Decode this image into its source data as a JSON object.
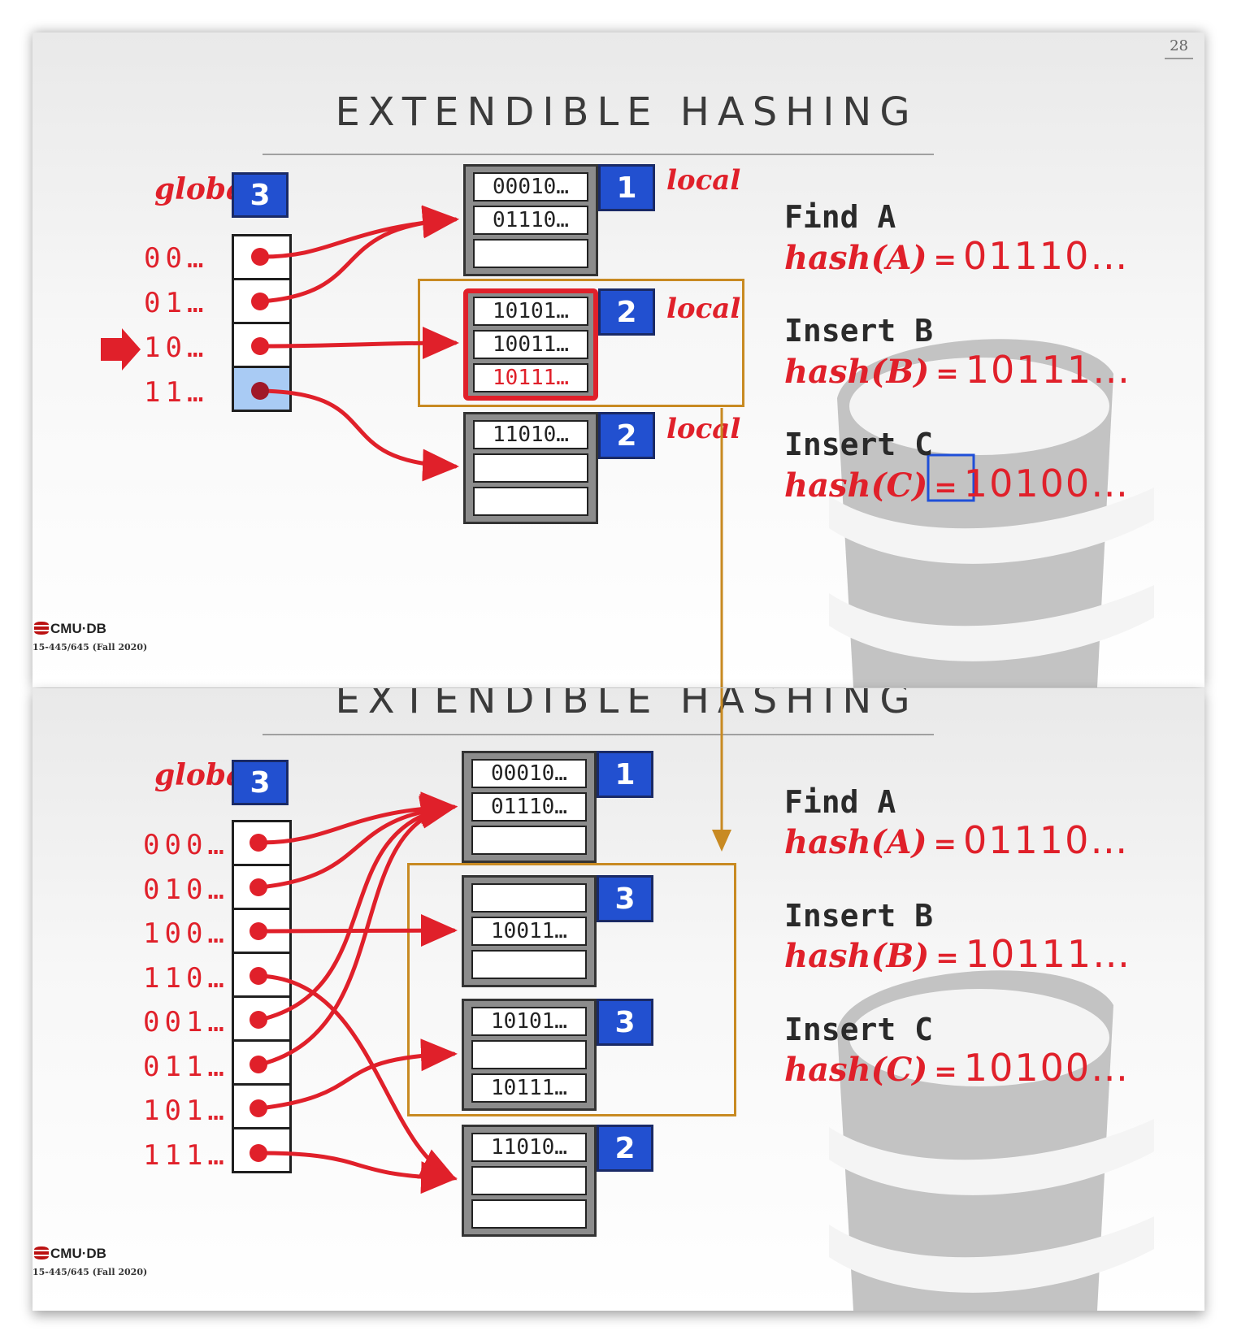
{
  "top": {
    "page_number": "28",
    "title": "EXTENDIBLE HASHING",
    "global_label": "global",
    "global_depth": "3",
    "directory": [
      "00…",
      "01…",
      "10…",
      "11…"
    ],
    "buckets": [
      {
        "slots": [
          "00010…",
          "01110…",
          ""
        ],
        "local_depth": "1",
        "local_label": "local"
      },
      {
        "slots": [
          "10101…",
          "10011…",
          "10111…"
        ],
        "local_depth": "2",
        "local_label": "local"
      },
      {
        "slots": [
          "11010…",
          "",
          ""
        ],
        "local_depth": "2",
        "local_label": "local"
      }
    ],
    "ops": [
      {
        "title": "Find A",
        "fn": "hash(A)",
        "eq": "=",
        "value": "01110…"
      },
      {
        "title": "Insert B",
        "fn": "hash(B)",
        "eq": "=",
        "value": "10111…"
      },
      {
        "title": "Insert C",
        "fn": "hash(C)",
        "eq": "=",
        "value": "10100…"
      }
    ],
    "footer_logo": "CMU·DB",
    "footer_course": "15-445/645 (Fall 2020)"
  },
  "bottom": {
    "title": "EXTENDIBLE HASHING",
    "global_label": "global",
    "global_depth": "3",
    "directory": [
      "000…",
      "010…",
      "100…",
      "110…",
      "001…",
      "011…",
      "101…",
      "111…"
    ],
    "buckets": [
      {
        "slots": [
          "00010…",
          "01110…",
          ""
        ],
        "local_depth": "1"
      },
      {
        "slots": [
          "",
          "10011…",
          ""
        ],
        "local_depth": "3"
      },
      {
        "slots": [
          "10101…",
          "",
          "10111…"
        ],
        "local_depth": "3"
      },
      {
        "slots": [
          "11010…",
          "",
          ""
        ],
        "local_depth": "2"
      }
    ],
    "ops": [
      {
        "title": "Find A",
        "fn": "hash(A)",
        "eq": "=",
        "value": "01110…"
      },
      {
        "title": "Insert B",
        "fn": "hash(B)",
        "eq": "=",
        "value": "10111…"
      },
      {
        "title": "Insert C",
        "fn": "hash(C)",
        "eq": "=",
        "value": "10100…"
      }
    ],
    "footer_logo": "CMU·DB",
    "footer_course": "15-445/645 (Fall 2020)"
  },
  "colors": {
    "accent_red": "#e0202a",
    "depth_blue": "#2250d0",
    "bracket_gold": "#c88a22",
    "highlight": "#a9cbf4"
  }
}
